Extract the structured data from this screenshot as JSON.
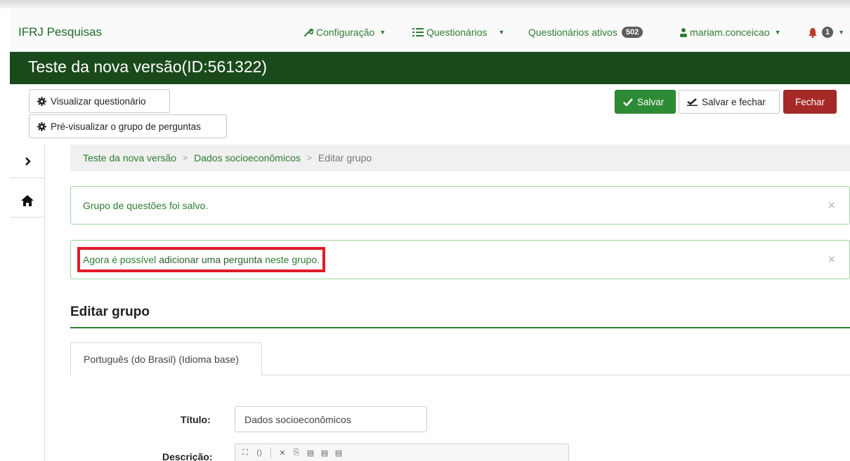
{
  "navbar": {
    "brand": "IFRJ Pesquisas",
    "configuracao": "Configuração",
    "questionarios": "Questionários",
    "questionarios_ativos": "Questionários ativos",
    "ativos_count": "502",
    "user": "mariam.conceicao",
    "notifications_count": "1"
  },
  "titlebar": {
    "title": "Teste da nova versão(ID:561322)"
  },
  "toolbar": {
    "visualizar": "Visualizar questionário",
    "pre_visualizar": "Pré-visualizar o grupo de perguntas",
    "salvar": "Salvar",
    "salvar_fechar": "Salvar e fechar",
    "fechar": "Fechar"
  },
  "breadcrumb": {
    "item1": "Teste da nova versão",
    "item2": "Dados socioeconômicos",
    "current": "Editar grupo",
    "sep": ">"
  },
  "alerts": {
    "saved": "Grupo de questões foi salvo.",
    "add_part1": "Agora é possível",
    "add_part2": "adicionar uma pergunta",
    "add_part3": "neste grupo.",
    "close": "×"
  },
  "section": {
    "title": "Editar grupo",
    "tab": "Português (do Brasil) (Idioma base)"
  },
  "form": {
    "titulo_label": "Título:",
    "titulo_value": "Dados socioeconômicos",
    "descricao_label": "Descrição:"
  },
  "colors": {
    "brand_green": "#1a4a1c",
    "link_green": "#2e7d32",
    "save_green": "#2e8b35",
    "close_red": "#a52a27",
    "highlight_red": "#e11b2a"
  }
}
